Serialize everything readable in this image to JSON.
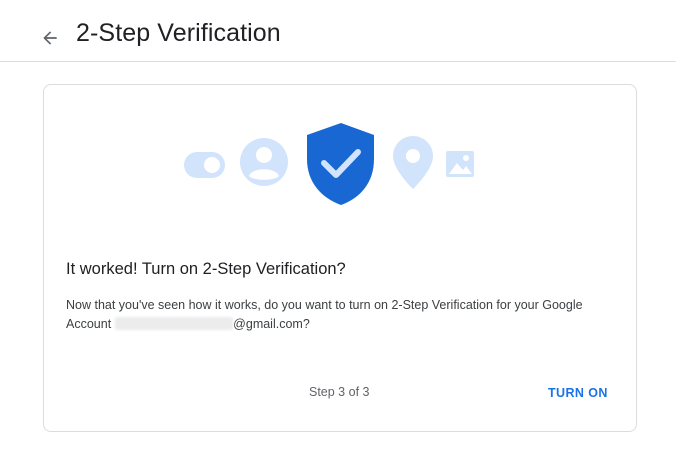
{
  "header": {
    "title": "2-Step Verification",
    "back_icon": "arrow-back-icon"
  },
  "card": {
    "heading": "It worked! Turn on 2-Step Verification?",
    "body_line1": "Now that you've seen how it works, do you want to turn on 2-Step Verification for your Google",
    "body_line2_prefix": "Account",
    "email_suffix": "@gmail.com?",
    "step": "Step 3 of 3",
    "turn_on_label": "TURN ON",
    "illustration_icons": [
      "toggle-icon",
      "account-icon",
      "shield-check-icon",
      "location-pin-icon",
      "image-icon"
    ]
  },
  "colors": {
    "accent": "#1a73e8",
    "shield": "#1967d2",
    "icon_light": "#d2e3fc",
    "border": "#dadce0"
  }
}
